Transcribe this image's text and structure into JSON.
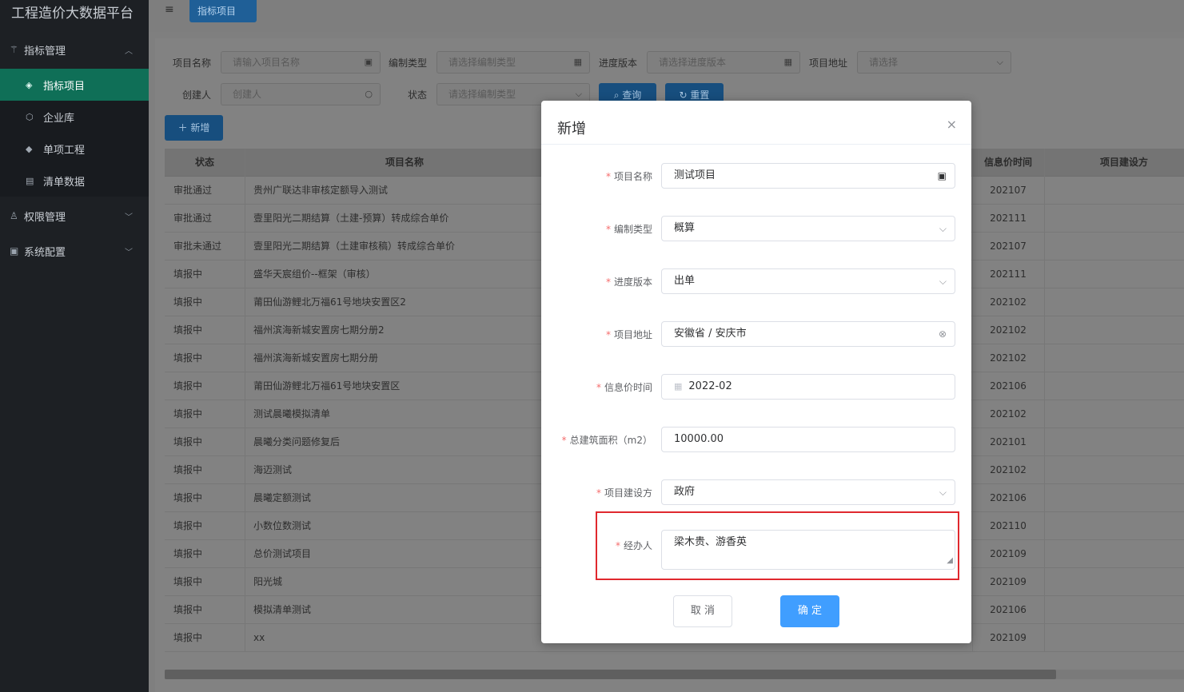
{
  "app": {
    "title": "工程造价大数据平台"
  },
  "sidebar": {
    "group1": {
      "label": "指标管理",
      "icon": "chart-icon",
      "arrow": "︿"
    },
    "items": [
      {
        "label": "指标项目",
        "icon": "layers-icon",
        "glyph": "◈"
      },
      {
        "label": "企业库",
        "icon": "cube-icon",
        "glyph": "⬡"
      },
      {
        "label": "单项工程",
        "icon": "stack-icon",
        "glyph": "◆"
      },
      {
        "label": "清单数据",
        "icon": "clipboard-icon",
        "glyph": "▤"
      }
    ],
    "group2": {
      "label": "权限管理",
      "icon": "user-lock-icon",
      "arrow": "﹀"
    },
    "group3": {
      "label": "系统配置",
      "icon": "config-icon",
      "arrow": "﹀"
    }
  },
  "topbar": {
    "menu_glyph": "≡",
    "tab_label": "指标项目"
  },
  "filters": {
    "project_name": {
      "label": "项目名称",
      "placeholder": "请输入项目名称"
    },
    "compile_type": {
      "label": "编制类型",
      "placeholder": "请选择编制类型"
    },
    "progress_version": {
      "label": "进度版本",
      "placeholder": "请选择进度版本"
    },
    "project_address": {
      "label": "项目地址",
      "placeholder": "请选择"
    },
    "creator": {
      "label": "创建人",
      "placeholder": "创建人"
    },
    "status": {
      "label": "状态",
      "placeholder": "请选择编制类型"
    },
    "search_label": "查询",
    "reset_label": "重置",
    "add_label": "新增"
  },
  "table": {
    "headers": {
      "status": "状态",
      "name": "项目名称",
      "info_time": "信息价时间",
      "builder": "项目建设方"
    },
    "rows": [
      {
        "status": "审批通过",
        "name": "贵州广联达非审核定额导入测试",
        "time": "202107"
      },
      {
        "status": "审批通过",
        "name": "壹里阳光二期结算（土建-预算）转成综合单价",
        "time": "202111"
      },
      {
        "status": "审批未通过",
        "name": "壹里阳光二期结算（土建审核稿）转成综合单价",
        "time": "202107"
      },
      {
        "status": "填报中",
        "name": "盛华天宸组价--框架（审核）",
        "time": "202111"
      },
      {
        "status": "填报中",
        "name": "莆田仙游鲤北万福61号地块安置区2",
        "time": "202102"
      },
      {
        "status": "填报中",
        "name": "福州滨海新城安置房七期分册2",
        "time": "202102"
      },
      {
        "status": "填报中",
        "name": "福州滨海新城安置房七期分册",
        "time": "202102"
      },
      {
        "status": "填报中",
        "name": "莆田仙游鲤北万福61号地块安置区",
        "time": "202106"
      },
      {
        "status": "填报中",
        "name": "测试晨曦模拟清单",
        "time": "202102"
      },
      {
        "status": "填报中",
        "name": "晨曦分类问题修复后",
        "time": "202101"
      },
      {
        "status": "填报中",
        "name": "海迈测试",
        "time": "202102"
      },
      {
        "status": "填报中",
        "name": "晨曦定额测试",
        "time": "202106"
      },
      {
        "status": "填报中",
        "name": "小数位数测试",
        "time": "202110"
      },
      {
        "status": "填报中",
        "name": "总价测试项目",
        "time": "202109"
      },
      {
        "status": "填报中",
        "name": "阳光城",
        "time": "202109"
      },
      {
        "status": "填报中",
        "name": "模拟清单测试",
        "time": "202106"
      },
      {
        "status": "填报中",
        "name": "xx",
        "time": "202109"
      }
    ]
  },
  "dialog": {
    "title": "新增",
    "close_glyph": "×",
    "fields": {
      "project_name": {
        "label": "项目名称",
        "value": "测试项目"
      },
      "compile_type": {
        "label": "编制类型",
        "value": "概算"
      },
      "progress_version": {
        "label": "进度版本",
        "value": "出单"
      },
      "project_address": {
        "label": "项目地址",
        "value": "安徽省 / 安庆市"
      },
      "info_time": {
        "label": "信息价时间",
        "value": "2022-02"
      },
      "total_area": {
        "label": "总建筑面积（m2）",
        "value": "10000.00"
      },
      "builder": {
        "label": "项目建设方",
        "value": "政府"
      },
      "handler": {
        "label": "经办人",
        "value": "梁木贵、游香英"
      }
    },
    "cancel_label": "取 消",
    "confirm_label": "确 定",
    "highlight_color": "#e0282e"
  },
  "colors": {
    "primary": "#409eff",
    "sidebar_bg": "#1d2024",
    "sidebar_active": "#0f6f57",
    "required": "#f56c6c"
  }
}
